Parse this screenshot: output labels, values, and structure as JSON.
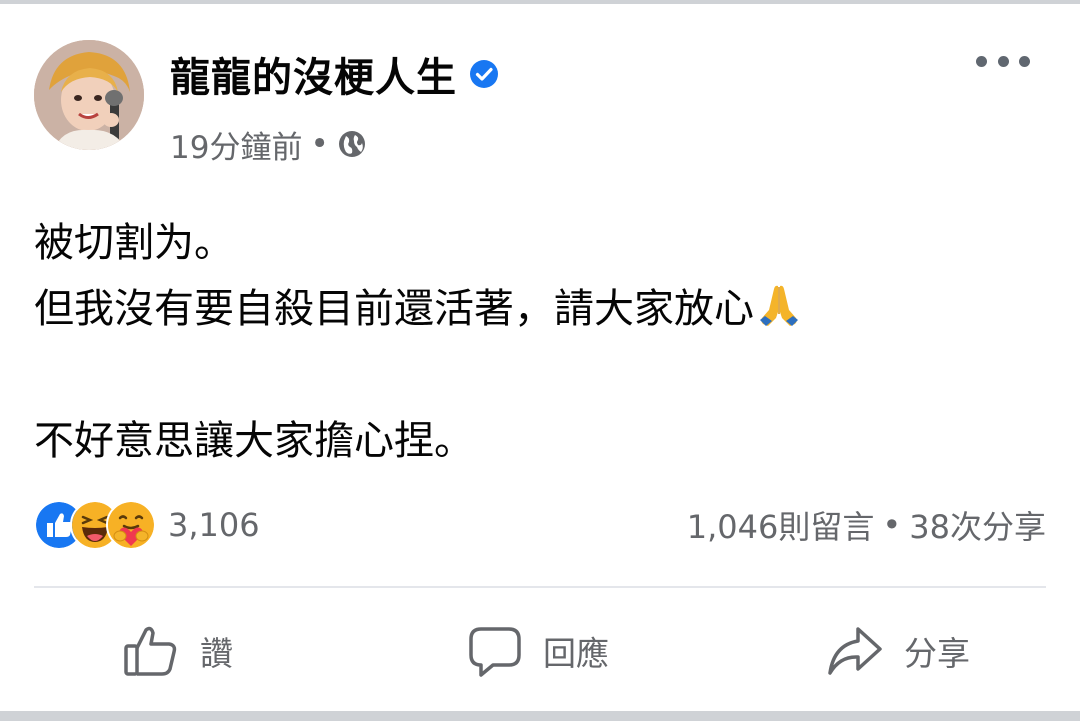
{
  "post": {
    "author_name": "龍龍的沒梗人生",
    "timestamp": "19分鐘前",
    "meta_separator": "•",
    "privacy_icon": "globe-icon",
    "verified_icon": "verified-badge-icon",
    "body_lines": [
      "被切割为。",
      "但我沒有要自殺目前還活著，請大家放心",
      "不好意思讓大家擔心捏。"
    ],
    "inline_emoji": "folded-hands-icon"
  },
  "reactions": {
    "icons": [
      "like-reaction-icon",
      "haha-reaction-icon",
      "care-reaction-icon"
    ],
    "count": "3,106"
  },
  "engagement": {
    "comments": "1,046則留言",
    "separator": "•",
    "shares": "38次分享"
  },
  "actions": {
    "like_label": "讚",
    "comment_label": "回應",
    "share_label": "分享"
  },
  "colors": {
    "text_primary": "#050505",
    "text_secondary": "#65676b",
    "verified_blue": "#1877f2",
    "like_blue": "#1877f2",
    "reaction_yellow": "#f7b125",
    "divider": "#e4e6eb"
  }
}
